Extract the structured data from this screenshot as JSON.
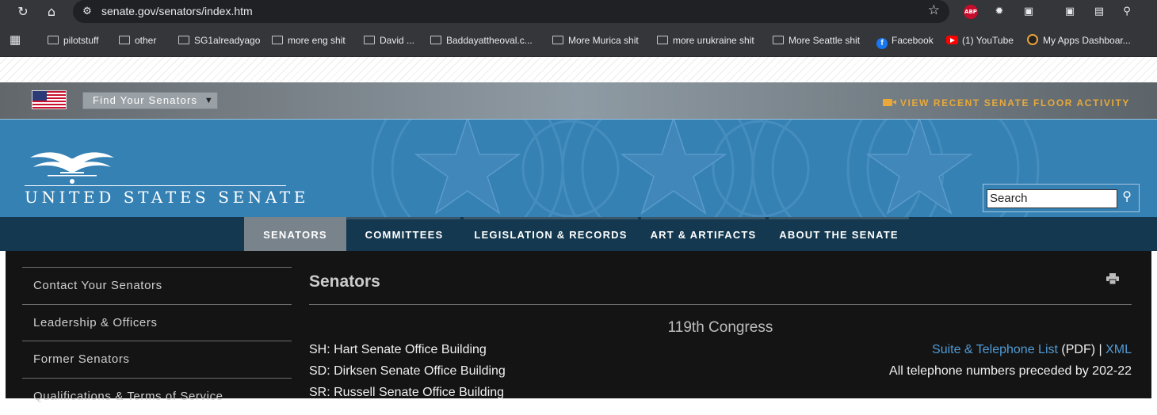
{
  "browser": {
    "url": "senate.gov/senators/index.htm",
    "extensions": [
      "abp-icon",
      "gear-extension-icon",
      "puzzle-icon",
      "screenshot-icon",
      "reader-icon",
      "search-page-icon"
    ],
    "abp_label": "ABP"
  },
  "bookmarks": [
    {
      "label": "pilotstuff",
      "icon": "folder-icon"
    },
    {
      "label": "other",
      "icon": "folder-icon"
    },
    {
      "label": "SG1alreadyago",
      "icon": "folder-icon"
    },
    {
      "label": "more eng shit",
      "icon": "folder-icon"
    },
    {
      "label": "David ...",
      "icon": "folder-icon"
    },
    {
      "label": "Baddayattheoval.c...",
      "icon": "folder-icon"
    },
    {
      "label": "More Murica shit",
      "icon": "folder-icon"
    },
    {
      "label": "more urukraine shit",
      "icon": "folder-icon"
    },
    {
      "label": "More Seattle shit",
      "icon": "folder-icon"
    },
    {
      "label": "Facebook",
      "icon": "facebook-icon"
    },
    {
      "label": "(1) YouTube",
      "icon": "youtube-icon"
    },
    {
      "label": "My Apps Dashboar...",
      "icon": "apps-icon"
    }
  ],
  "utility": {
    "find_senators": "Find Your Senators",
    "floor_activity": "VIEW RECENT SENATE FLOOR ACTIVITY",
    "accent": "#e8a93a"
  },
  "header": {
    "logo_text": "UNITED STATES SENATE",
    "search_placeholder": "Search",
    "banner_color": "#3581b4"
  },
  "nav": {
    "items": [
      "SENATORS",
      "COMMITTEES",
      "LEGISLATION & RECORDS",
      "ART & ARTIFACTS",
      "ABOUT THE SENATE"
    ],
    "active": "SENATORS"
  },
  "sidebar": {
    "items": [
      "Contact Your Senators",
      "Leadership & Officers",
      "Former Senators",
      "Qualifications & Terms of Service"
    ]
  },
  "main": {
    "title": "Senators",
    "congress": "119th Congress",
    "buildings": [
      "SH: Hart Senate Office Building",
      "SD: Dirksen Senate Office Building",
      "SR: Russell Senate Office Building"
    ],
    "suite_link": "Suite & Telephone List",
    "pdf_label": " (PDF) ",
    "separator": "|",
    "xml_link": " XML",
    "phone_note": "All telephone numbers preceded by 202-22"
  }
}
